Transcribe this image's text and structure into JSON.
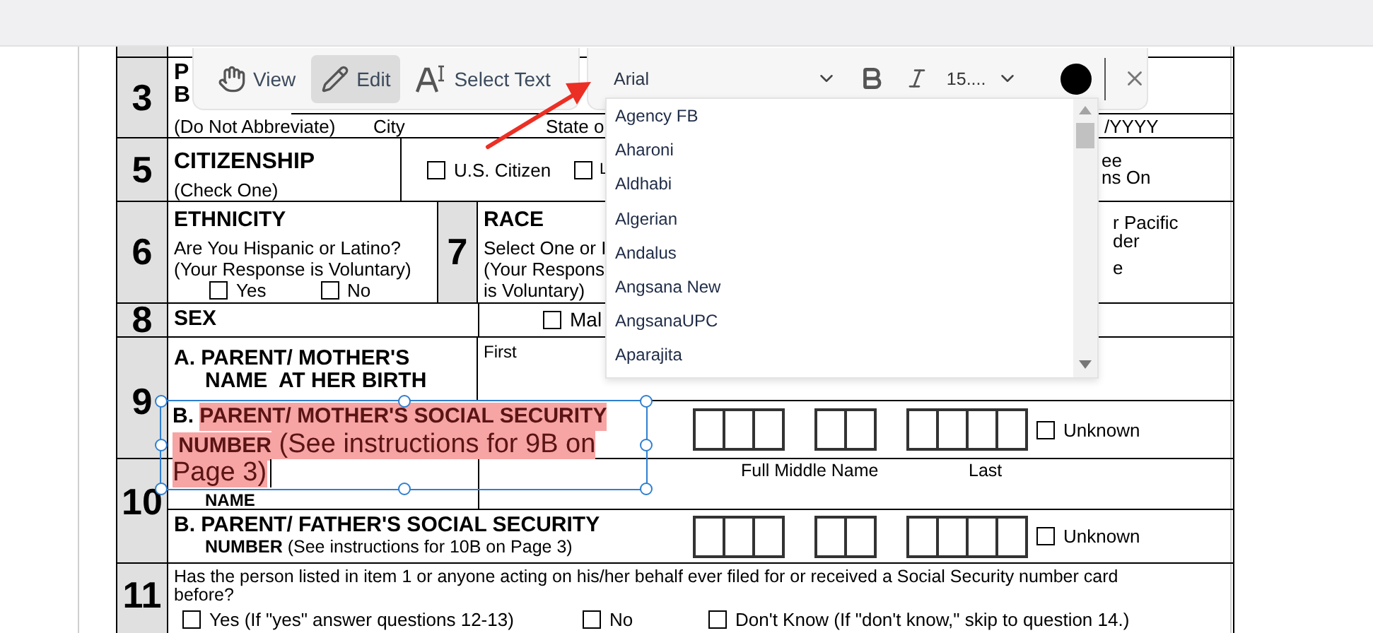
{
  "toolbar": {
    "modes": [
      {
        "label": "View",
        "selected": false,
        "kind": "hand"
      },
      {
        "label": "Edit",
        "selected": true,
        "kind": "pencil"
      },
      {
        "label": "Select Text",
        "selected": false,
        "kind": "text"
      }
    ],
    "font": "Arial",
    "size": "15...."
  },
  "font_options": [
    "Agency FB",
    "Aharoni",
    "Aldhabi",
    "Algerian",
    "Andalus",
    "Angsana New",
    "AngsanaUPC",
    "Aparajita"
  ],
  "text_box": {
    "lines": [
      [
        {
          "text": "B. ",
          "kind": "label",
          "highlighted": false
        },
        {
          "text": "PARENT/ MOTHER'S SOCIAL SECURITY",
          "kind": "label",
          "highlighted": true
        }
      ],
      [
        {
          "text": " NUMBER",
          "kind": "label",
          "highlighted": true
        },
        {
          "text": " (See instructions for 9B on",
          "kind": "typed",
          "highlighted": true
        }
      ],
      [
        {
          "text": "Page 3)",
          "kind": "typed",
          "highlighted": true
        }
      ]
    ]
  },
  "form": {
    "row_3": {
      "number": "3",
      "heading": [
        "P",
        "B"
      ],
      "labels": [
        "(Do Not Abbreviate)",
        "City",
        "State o",
        "/YYYY"
      ]
    },
    "row_5": {
      "number": "5",
      "title": "CITIZENSHIP",
      "subtitle": "(Check One)",
      "option": {
        "label": "U.S. Citizen",
        "checked": false
      },
      "option_2": {
        "checked": false,
        "letters": [
          "L"
        ]
      },
      "fragment": [
        "ee",
        "ns On"
      ]
    },
    "row_6": {
      "number": "6",
      "title": "ETHNICITY",
      "lines": [
        "Are You Hispanic or Latino?",
        "(Your Response is Voluntary)"
      ],
      "options": [
        {
          "label": "Yes",
          "checked": false
        },
        {
          "label": "No",
          "checked": false
        }
      ]
    },
    "row_7": {
      "number": "7",
      "title": "RACE",
      "lines": [
        "Select One or I",
        "(Your Respons",
        "is Voluntary)"
      ],
      "fragment": [
        "r Pacific",
        "der",
        "e"
      ]
    },
    "row_8": {
      "number": "8",
      "title": "SEX",
      "option": {
        "label": "Mal",
        "checked": false
      }
    },
    "row_9": {
      "number": "9",
      "a_label": [
        "A. PARENT/ MOTHER'S",
        "NAME  AT HER BIRTH"
      ],
      "first": "First",
      "unknown": {
        "label": "Unknown",
        "checked": false
      }
    },
    "row_10": {
      "number": "10",
      "a_label": "NAME",
      "name_parts": [
        "Full Middle Name",
        "Last"
      ],
      "b_label": "B. PARENT/ FATHER'S SOCIAL SECURITY",
      "b_line": "**NUMBER** (See instructions for 10B on Page 3)",
      "unknown": {
        "label": "Unknown",
        "checked": false
      }
    },
    "row_11": {
      "number": "11",
      "question": "Has the person listed in item 1 or anyone acting on his/her behalf ever filed for or received a Social Security number card before?",
      "options": [
        {
          "label": "Yes (If \"yes\" answer questions 12-13)",
          "checked": false
        },
        {
          "label": "No",
          "checked": false
        },
        {
          "label": "Don't Know (If \"don't know,\" skip to question 14.)",
          "checked": false
        }
      ]
    }
  }
}
